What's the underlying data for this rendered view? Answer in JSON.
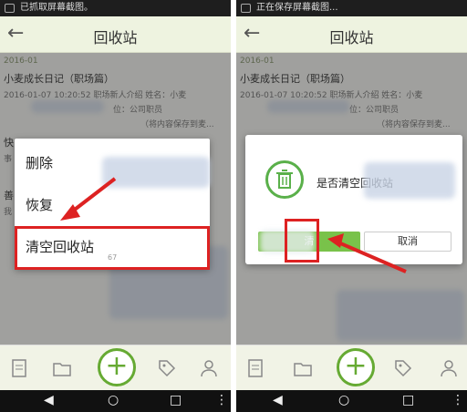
{
  "left": {
    "status_text": "已抓取屏幕截图。",
    "app_title": "回收站",
    "date": "2016-01",
    "note1": {
      "title": "小麦成长日记（职场篇）",
      "line1": "2016-01-07 10:20:52  职场新人介绍    姓名：小麦",
      "line2": "位：公司职员",
      "line3": "（将内容保存到麦..."
    },
    "note2_prefix": "快",
    "note2_line": "事",
    "note3_prefix": "善",
    "note3_line": "我",
    "menu": {
      "delete": "删除",
      "restore": "恢复",
      "clear": "清空回收站"
    },
    "partial_text": "67"
  },
  "right": {
    "status_text": "正在保存屏幕截图...",
    "app_title": "回收站",
    "date": "2016-01",
    "note1": {
      "title": "小麦成长日记（职场篇）",
      "line1": "2016-01-07 10:20:52  职场新人介绍    姓名：小麦",
      "line2": "位：公司职员",
      "line3": "（将内容保存到麦..."
    },
    "dialog": {
      "message": "是否清空回收站",
      "ok": "清",
      "cancel": "取消"
    }
  },
  "colors": {
    "accent": "#66aa33",
    "highlight": "#dd2222",
    "appbar": "#eef3e0"
  }
}
